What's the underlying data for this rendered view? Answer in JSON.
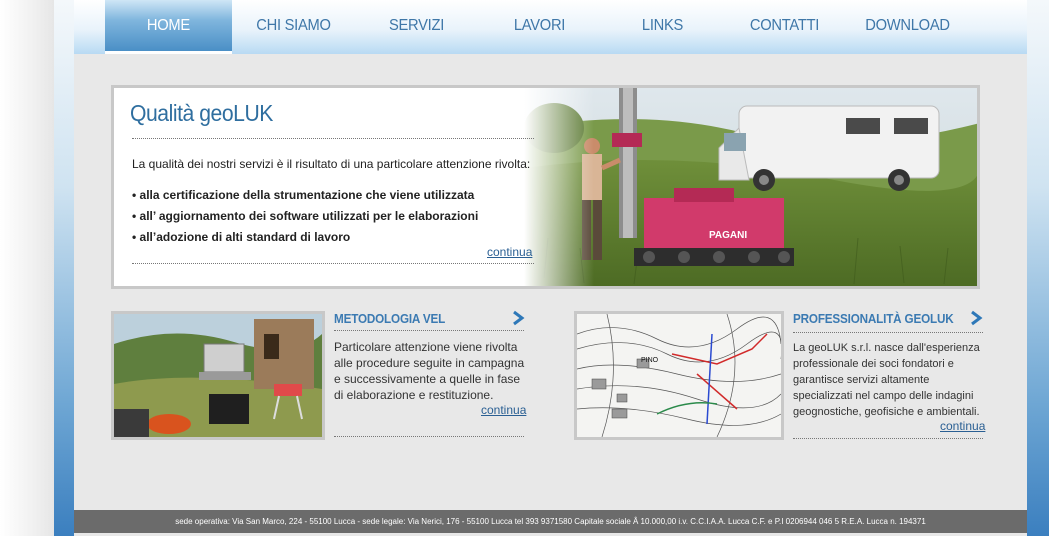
{
  "nav": {
    "items": [
      "HOME",
      "CHI SIAMO",
      "SERVIZI",
      "LAVORI",
      "LINKS",
      "CONTATTI",
      "DOWNLOAD"
    ],
    "active_index": 0
  },
  "hero": {
    "title": "Qualità geoLUK",
    "intro": "La qualità dei nostri servizi è il risultato di una particolare attenzione rivolta:",
    "bullets": [
      "• alla certificazione della strumentazione che viene utilizzata",
      "• all’ aggiornamento dei software utilizzati per le elaborazioni",
      "• all’adozione di alti standard di lavoro"
    ],
    "link": "continua"
  },
  "card_left": {
    "title": "METODOLOGIA VEL",
    "lines": [
      "Particolare attenzione viene rivolta",
      "alle procedure seguite in campagna",
      "e successivamente a quelle in fase",
      "di elaborazione e restituzione."
    ],
    "link": "continua"
  },
  "card_right": {
    "title": "PROFESSIONALITÀ GEOLUK",
    "lines": [
      "La geoLUK s.r.l. nasce dall'esperienza",
      "professionale dei soci fondatori e",
      "garantisce servizi altamente",
      "specializzati nel campo delle indagini",
      "geognostiche, geofisiche e ambientali."
    ],
    "link": "continua",
    "map_label": "PINO"
  },
  "footer": {
    "text": "sede operativa: Via San Marco, 224 - 55100 Lucca  - sede legale: Via Nerici, 176 - 55100 Lucca tel 393 9371580  Capitale sociale Â 10.000,00 i.v. C.C.I.A.A. Lucca C.F. e P.I 0206944 046 5 R.E.A. Lucca n. 194371"
  },
  "colors": {
    "nav_text": "#3f77a8",
    "title_blue": "#2f6e9f",
    "link_blue": "#2a5f93",
    "footer_bg": "#6b6b6b"
  }
}
